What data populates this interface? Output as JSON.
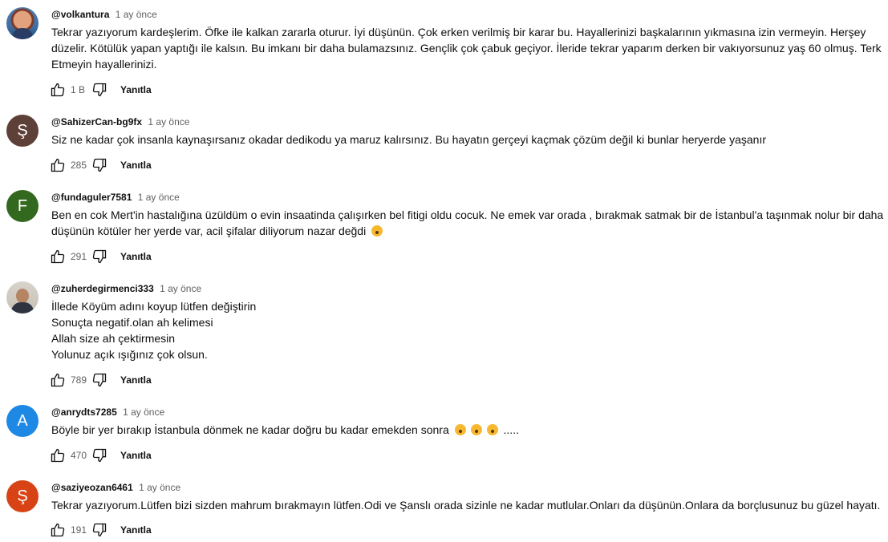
{
  "comments": [
    {
      "author": "@volkantura",
      "time": "1 ay önce",
      "lines": [
        "Tekrar yazıyorum kardeşlerim. Öfke ile kalkan zararla oturur. İyi düşünün. Çok erken verilmiş bir karar bu. Hayallerinizi başkalarının yıkmasına izin vermeyin. Herşey",
        "düzelir. Kötülük yapan yaptığı ile kalsın. Bu imkanı bir daha bulamazsınız. Gençlik çok çabuk geçiyor. İleride tekrar yaparım derken bir vakıyorsunuz yaş 60 olmuş. Terk",
        "Etmeyin hayallerinizi."
      ],
      "likes": "1 B",
      "reply": "Yanıtla",
      "avatar_letter": "",
      "avatar_color": "#3f6fa3"
    },
    {
      "author": "@SahizerCan-bg9fx",
      "time": "1 ay önce",
      "lines": [
        "Siz ne kadar çok insanla kaynaşırsanız okadar dedikodu ya maruz kalırsınız. Bu hayatın gerçeyi kaçmak çözüm değil ki bunlar heryerde yaşanır"
      ],
      "likes": "285",
      "reply": "Yanıtla",
      "avatar_letter": "Ş",
      "avatar_color": "#5d4037"
    },
    {
      "author": "@fundaguler7581",
      "time": "1 ay önce",
      "lines": [
        "Ben en cok Mert'in hastalığına üzüldüm o evin insaatinda çalışırken bel fitigi oldu cocuk. Ne emek var orada , bırakmak satmak bir de İstanbul'a taşınmak nolur bir daha",
        "düşünün kötüler her yerde var, acil şifalar diliyorum nazar değdi"
      ],
      "likes": "291",
      "reply": "Yanıtla",
      "avatar_letter": "F",
      "avatar_color": "#33691e"
    },
    {
      "author": "@zuherdegirmenci333",
      "time": "1 ay önce",
      "lines": [
        "İllede Köyüm adını koyup lütfen değiştirin",
        "Sonuçta negatif.olan ah  kelimesi",
        "Allah size ah çektirmesin",
        "Yolunuz açık ışığınız  çok olsun."
      ],
      "likes": "789",
      "reply": "Yanıtla",
      "avatar_letter": "",
      "avatar_color": "#c7c0b5"
    },
    {
      "author": "@anrydts7285",
      "time": "1 ay önce",
      "lines": [
        "Böyle bir yer bırakıp İstanbula dönmek ne kadar doğru bu kadar emekden sonra"
      ],
      "emoji_suffix": " .....",
      "likes": "470",
      "reply": "Yanıtla",
      "avatar_letter": "A",
      "avatar_color": "#1e88e5"
    },
    {
      "author": "@saziyeozan6461",
      "time": "1 ay önce",
      "lines": [
        "Tekrar yazıyorum.Lütfen bizi sizden mahrum bırakmayın lütfen.Odi ve Şanslı orada sizinle ne kadar mutlular.Onları da düşünün.Onlara da borçlusunuz bu güzel hayatı."
      ],
      "likes": "191",
      "reply": "Yanıtla",
      "avatar_letter": "Ş",
      "avatar_color": "#d84315"
    }
  ]
}
